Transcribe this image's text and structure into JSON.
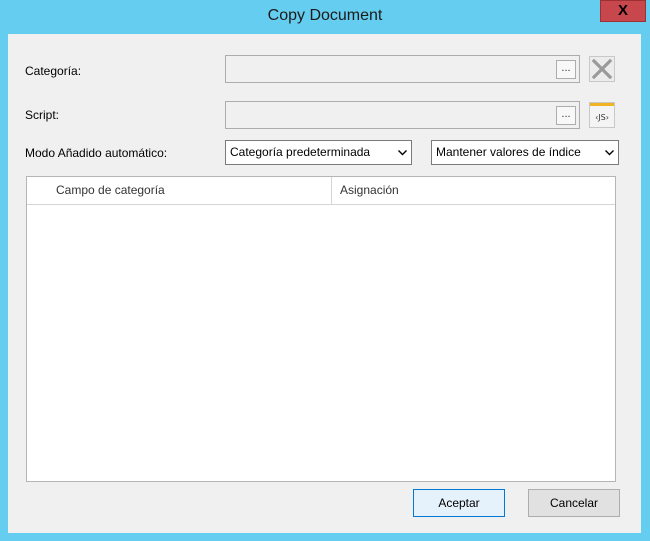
{
  "window": {
    "title": "Copy Document",
    "close_label": "X"
  },
  "form": {
    "categoria_label": "Categoría:",
    "categoria_value": "",
    "script_label": "Script:",
    "script_value": "",
    "ellipsis_label": "...",
    "js_label": "‹JS›",
    "modo_label": "Modo Añadido automático:",
    "modo_select_1": "Categoría predeterminada",
    "modo_select_2": "Mantener valores de índice"
  },
  "grid": {
    "columns": [
      "Campo de categoría",
      "Asignación"
    ],
    "rows": []
  },
  "buttons": {
    "ok": "Aceptar",
    "cancel": "Cancelar"
  },
  "colors": {
    "frame": "#65cdef",
    "close": "#c7474d",
    "client": "#f0f0f0",
    "accent": "#0078d7"
  }
}
